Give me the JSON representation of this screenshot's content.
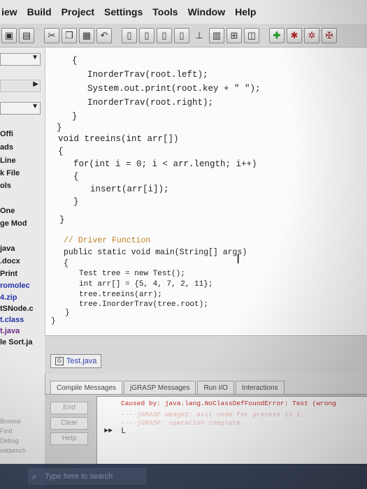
{
  "menu": [
    "iew",
    "Build",
    "Project",
    "Settings",
    "Tools",
    "Window",
    "Help"
  ],
  "toolbar": {
    "icons": [
      "window-icon",
      "save-icon",
      "cut-icon",
      "copy-icon",
      "paste-icon",
      "undo-icon",
      "page-icon",
      "page-icon",
      "page-icon",
      "page-icon",
      "pin-icon",
      "chart-icon",
      "diagram-icon",
      "book-icon",
      "add-icon",
      "run-icon",
      "debug-icon",
      "settings-icon"
    ]
  },
  "left_panel": {
    "files": [
      "Offi",
      "ads",
      "Line",
      "k File",
      "ols",
      "One",
      "ge Mod",
      "java",
      ".docx",
      "Print",
      "romolec",
      "4.zip",
      "tSNode.c",
      "t.class",
      "t.java",
      "le Sort.ja"
    ],
    "side_labels": [
      "Browse",
      "Find",
      "Debug",
      "orkbench"
    ]
  },
  "editor": {
    "lines": [
      "{",
      "InorderTrav(root.left);",
      "System.out.print(root.key + \" \");",
      "InorderTrav(root.right);",
      "}",
      "}",
      "void treeins(int arr[])",
      "{",
      "for(int i = 0; i < arr.length; i++)",
      "{",
      "insert(arr[i]);",
      "}",
      "}",
      "// Driver Function",
      "public static void main(String[] args)",
      "{",
      "Test tree = new Test();",
      "int arr[] = {5, 4, 7, 2, 11};",
      "tree.treeins(arr);",
      "tree.InorderTrav(tree.root);",
      "}",
      "}"
    ]
  },
  "file_tab": {
    "label": "Test.java"
  },
  "bottom": {
    "tabs": [
      "Compile Messages",
      "jGRASP Messages",
      "Run I/O",
      "Interactions"
    ],
    "buttons": [
      "End",
      "Clear",
      "Help"
    ],
    "output": {
      "line1": "Caused by: java.lang.NoClassDefFoundError: Test (wrong",
      "line2": "----jGRASP wedge2: exit code for process is 1.",
      "line3": "----jGRASP: operation complete.",
      "prompt": "►►"
    }
  },
  "taskbar": {
    "search_placeholder": "Type here to search"
  }
}
